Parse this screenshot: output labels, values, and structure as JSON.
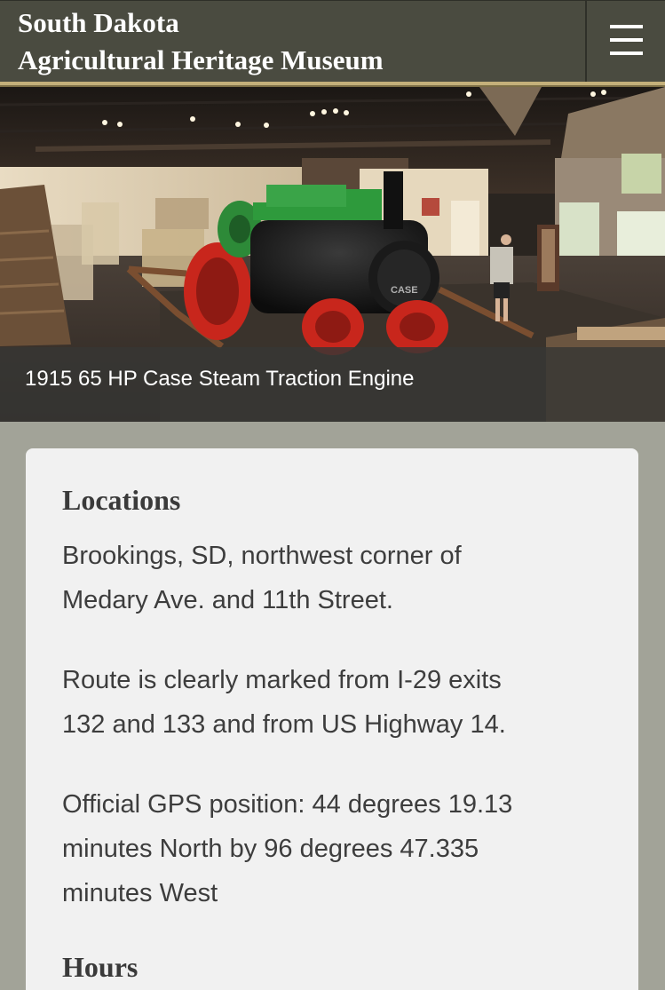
{
  "header": {
    "title_line1": "South Dakota",
    "title_line2": "Agricultural Heritage Museum",
    "menu_icon": "hamburger-menu-icon"
  },
  "hero": {
    "caption": "1915 65 HP Case Steam Traction Engine"
  },
  "colors": {
    "header_bg": "#4a4b40",
    "accent": "#c4b07a",
    "page_bg": "#a2a398",
    "card_bg": "#f1f1f1"
  },
  "content": {
    "locations": {
      "heading": "Locations",
      "address_lines": [
        "Brookings, SD, northwest corner of",
        "Medary Ave. and 11th Street."
      ],
      "route_lines": [
        "Route is clearly marked from I-29 exits",
        "132 and 133 and from US Highway 14."
      ],
      "gps_lines": [
        "Official GPS position: 44 degrees 19.13",
        "minutes North by 96 degrees 47.335",
        "minutes West"
      ]
    },
    "hours": {
      "heading": "Hours"
    }
  }
}
